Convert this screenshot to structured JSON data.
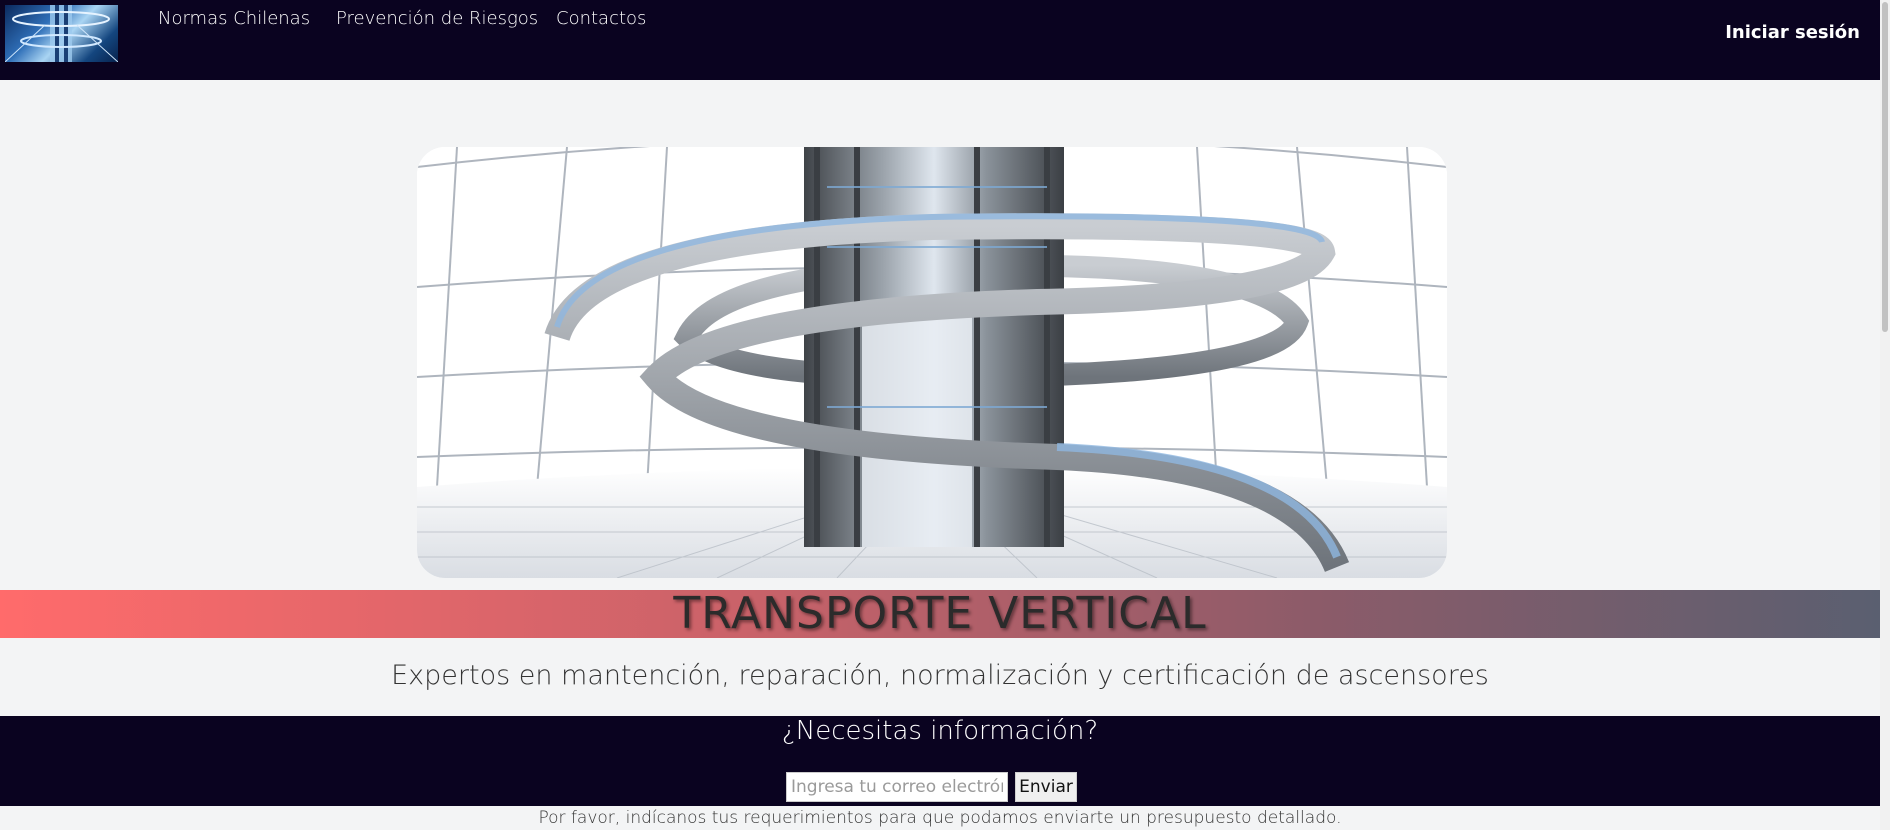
{
  "nav": {
    "logo_icon": "elevator-tower-logo",
    "links": [
      {
        "label": "Normas Chilenas"
      },
      {
        "label": "Prevención de Riesgos"
      },
      {
        "label": "Contactos"
      }
    ],
    "login_label": "Iniciar sesión"
  },
  "hero": {
    "image_icon": "spiral-elevator-tower-image"
  },
  "banner": {
    "title": "TRANSPORTE VERTICAL"
  },
  "tagline": "Expertos en mantención, reparación, normalización y certificación de ascensores",
  "info": {
    "title": "¿Necesitas información?",
    "email_placeholder": "Ingresa tu correo electrónico",
    "send_label": "Enviar"
  },
  "footer_note": "Por favor, indícanos tus requerimientos para que podamos enviarte un presupuesto detallado.",
  "colors": {
    "navbar": "#0a0320",
    "page_bg": "#f3f4f5",
    "banner_start": "#ff6b6b",
    "banner_end": "#5a5f70"
  }
}
